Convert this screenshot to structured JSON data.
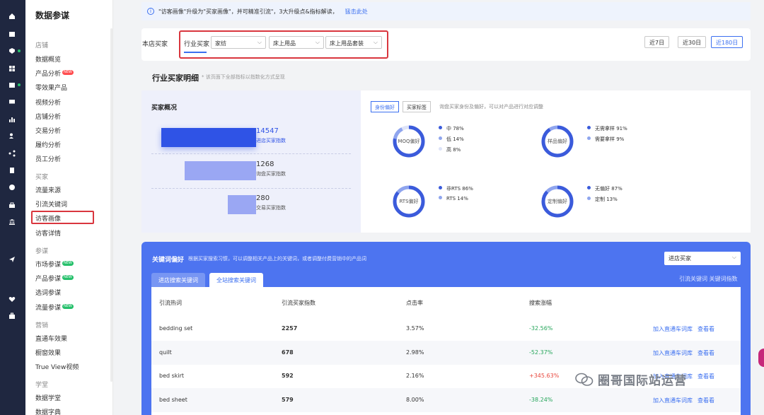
{
  "rail_icons": [
    "home-icon",
    "calendar-icon",
    "shield-icon",
    "grid-icon",
    "store-icon",
    "message-icon",
    "chart-icon",
    "users-icon",
    "share-icon",
    "clipboard-icon",
    "globe-icon",
    "bag-icon",
    "bank-icon",
    "send-icon",
    "heart-icon",
    "briefcase-icon"
  ],
  "nav": {
    "title": "数据参谋",
    "sections": [
      {
        "label": "店铺",
        "items": [
          {
            "label": "数据概览"
          },
          {
            "label": "产品分析",
            "badge": "NEW"
          },
          {
            "label": "零效果产品"
          },
          {
            "label": "视频分析"
          },
          {
            "label": "店铺分析"
          },
          {
            "label": "交易分析"
          },
          {
            "label": "履约分析"
          },
          {
            "label": "员工分析"
          }
        ]
      },
      {
        "label": "买家",
        "items": [
          {
            "label": "流量来源"
          },
          {
            "label": "引流关键词"
          },
          {
            "label": "访客画像"
          },
          {
            "label": "访客详情"
          }
        ]
      },
      {
        "label": "参谋",
        "items": [
          {
            "label": "市场参谋",
            "badge": "NEW"
          },
          {
            "label": "产品参谋",
            "badge": "NEW"
          },
          {
            "label": "选词参谋"
          },
          {
            "label": "流量参谋",
            "badge": "NEW"
          }
        ]
      },
      {
        "label": "营销",
        "items": [
          {
            "label": "直通车效果"
          },
          {
            "label": "橱窗效果"
          },
          {
            "label": "True View视频"
          }
        ]
      },
      {
        "label": "学堂",
        "items": [
          {
            "label": "数据学堂"
          },
          {
            "label": "数据字典"
          }
        ]
      }
    ]
  },
  "info": {
    "text": "\"访客画像\"升级为\"买家画像\"，并可精准引流\"，3大升级点&指标解读，",
    "link": "猛击此处"
  },
  "filter": {
    "store_label": "本店买家",
    "tab": "行业买家",
    "selects": [
      "家纺",
      "床上用品",
      "床上用品套装"
    ],
    "dates": [
      "近7日",
      "近30日",
      "近180日"
    ],
    "active_date": "近180日"
  },
  "section": {
    "title": "行业买家明细",
    "note": "* 该页面下全部指标以指数化方式呈现"
  },
  "overview": {
    "title": "买家概况",
    "funnel": [
      {
        "value": "14547",
        "label": "进店买家指数",
        "width_fraction": 1.0
      },
      {
        "value": "1268",
        "label": "询盘买家指数",
        "width_fraction": 0.75
      },
      {
        "value": "280",
        "label": "交易买家指数",
        "width_fraction": 0.3
      }
    ]
  },
  "preference": {
    "tabs": [
      "身份偏好",
      "买家标签"
    ],
    "active_tab": "身份偏好",
    "hint": "询盘买家身份及偏好，可以对产品进行对应调整",
    "donuts": [
      {
        "label": "MOQ偏好",
        "legend": [
          {
            "text": "中 78%",
            "pct": 78,
            "color": "#3b5bdb"
          },
          {
            "text": "低 14%",
            "pct": 14,
            "color": "#8fa5ee"
          },
          {
            "text": "高 8%",
            "pct": 8,
            "color": "#dde3f8"
          }
        ]
      },
      {
        "label": "样品偏好",
        "legend": [
          {
            "text": "无需拿样 91%",
            "pct": 91,
            "color": "#3b5bdb"
          },
          {
            "text": "需要拿样 9%",
            "pct": 9,
            "color": "#8fa5ee"
          }
        ]
      },
      {
        "label": "RTS偏好",
        "legend": [
          {
            "text": "非RTS 86%",
            "pct": 86,
            "color": "#3b5bdb"
          },
          {
            "text": "RTS 14%",
            "pct": 14,
            "color": "#8fa5ee"
          }
        ]
      },
      {
        "label": "定制偏好",
        "legend": [
          {
            "text": "无偏好 87%",
            "pct": 87,
            "color": "#3b5bdb"
          },
          {
            "text": "定制 13%",
            "pct": 13,
            "color": "#8fa5ee"
          }
        ]
      }
    ]
  },
  "keywords": {
    "title": "关键词偏好",
    "desc": "根据买家搜索习惯，可以调整相关产品上的关键词，或者调整付费营销中的产品词",
    "select": "进店买家",
    "links": "引流关键词   关键词指数",
    "tabs": [
      "进店搜索关键词",
      "全站搜索关键词"
    ],
    "active_tab": "全站搜索关键词",
    "columns": [
      "引流热词",
      "引流买家指数",
      "点击率",
      "搜索涨幅"
    ],
    "action1": "加入直通车词库",
    "action2": "查看看",
    "rows": [
      {
        "word": "bedding set",
        "index": "2257",
        "ctr": "3.57%",
        "growth": "-32.56%",
        "trend": "neg"
      },
      {
        "word": "quilt",
        "index": "678",
        "ctr": "2.98%",
        "growth": "-52.37%",
        "trend": "neg"
      },
      {
        "word": "bed skirt",
        "index": "592",
        "ctr": "2.16%",
        "growth": "+345.63%",
        "trend": "pos"
      },
      {
        "word": "bed sheet",
        "index": "579",
        "ctr": "8.00%",
        "growth": "-38.24%",
        "trend": "neg"
      }
    ]
  },
  "watermark": "圈哥国际站运营"
}
